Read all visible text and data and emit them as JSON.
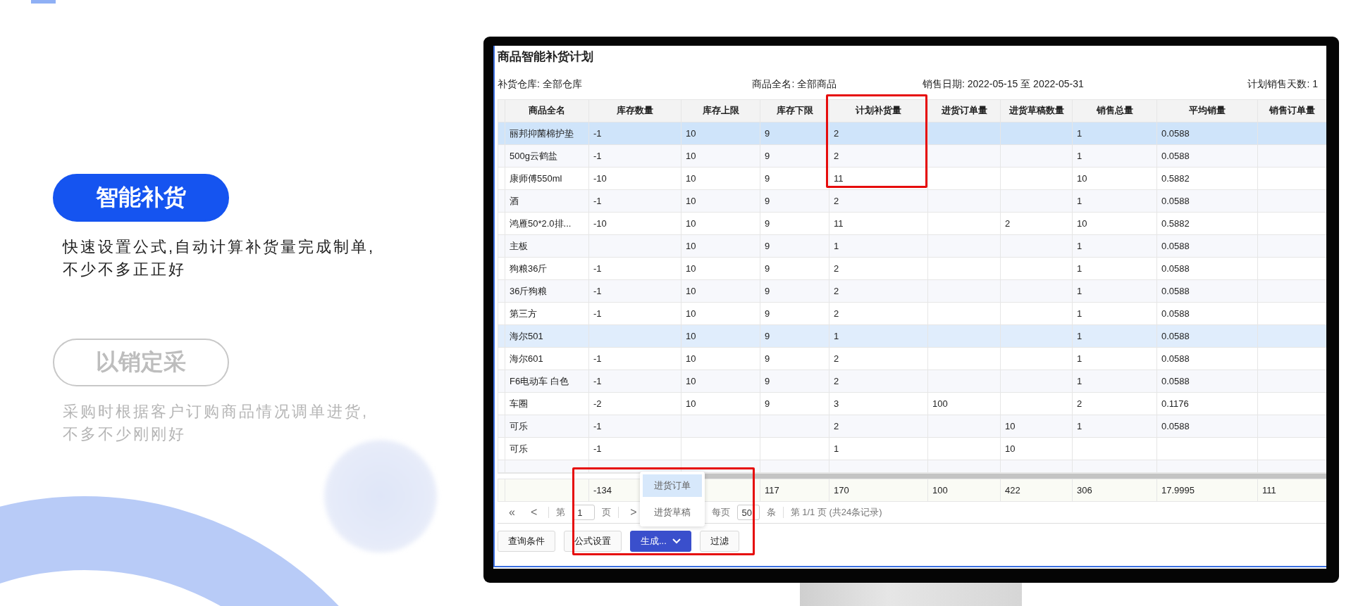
{
  "tabs": [
    {
      "label": "智能补货",
      "description": "快速设置公式,自动计算补货量完成制单,\n不少不多正正好",
      "selected": true
    },
    {
      "label": "以销定采",
      "description": "采购时根据客户订购商品情况调单进货,\n不多不少刚刚好",
      "selected": false
    }
  ],
  "screen": {
    "title": "商品智能补货计划",
    "filters": [
      "补货仓库: 全部仓库",
      "商品全名: 全部商品",
      "销售日期: 2022-05-15 至 2022-05-31",
      "计划销售天数: 1"
    ],
    "table": {
      "columns": [
        "商品全名",
        "库存数量",
        "库存上限",
        "库存下限",
        "计划补货量",
        "进货订单量",
        "进货草稿数量",
        "销售总量",
        "平均销量",
        "销售订单量"
      ],
      "rows": [
        {
          "cells": [
            "丽邦抑菌棉护垫",
            "-1",
            "10",
            "9",
            "2",
            null,
            null,
            "1",
            "0.0588",
            null
          ],
          "selected": true,
          "highlighted": false
        },
        {
          "cells": [
            "500g云鹤盐",
            "-1",
            "10",
            "9",
            "2",
            null,
            null,
            "1",
            "0.0588",
            null
          ],
          "selected": false,
          "highlighted": false
        },
        {
          "cells": [
            "康师傅550ml",
            "-10",
            "10",
            "9",
            "11",
            null,
            null,
            "10",
            "0.5882",
            null
          ],
          "selected": false,
          "highlighted": false
        },
        {
          "cells": [
            "酒",
            "-1",
            "10",
            "9",
            "2",
            null,
            null,
            "1",
            "0.0588",
            null
          ],
          "selected": false,
          "highlighted": false
        },
        {
          "cells": [
            "鸿雁50*2.0排...",
            "-10",
            "10",
            "9",
            "11",
            null,
            "2",
            "10",
            "0.5882",
            null
          ],
          "selected": false,
          "highlighted": false
        },
        {
          "cells": [
            "主板",
            null,
            "10",
            "9",
            "1",
            null,
            null,
            "1",
            "0.0588",
            null
          ],
          "selected": false,
          "highlighted": false
        },
        {
          "cells": [
            "狗粮36斤",
            "-1",
            "10",
            "9",
            "2",
            null,
            null,
            "1",
            "0.0588",
            null
          ],
          "selected": false,
          "highlighted": false
        },
        {
          "cells": [
            "36斤狗粮",
            "-1",
            "10",
            "9",
            "2",
            null,
            null,
            "1",
            "0.0588",
            null
          ],
          "selected": false,
          "highlighted": false
        },
        {
          "cells": [
            "第三方",
            "-1",
            "10",
            "9",
            "2",
            null,
            null,
            "1",
            "0.0588",
            null
          ],
          "selected": false,
          "highlighted": false
        },
        {
          "cells": [
            "海尔501",
            null,
            "10",
            "9",
            "1",
            null,
            null,
            "1",
            "0.0588",
            null
          ],
          "selected": false,
          "highlighted": true
        },
        {
          "cells": [
            "海尔601",
            "-1",
            "10",
            "9",
            "2",
            null,
            null,
            "1",
            "0.0588",
            null
          ],
          "selected": false,
          "highlighted": false
        },
        {
          "cells": [
            "F6电动车 白色",
            "-1",
            "10",
            "9",
            "2",
            null,
            null,
            "1",
            "0.0588",
            null
          ],
          "selected": false,
          "highlighted": false
        },
        {
          "cells": [
            "车圈",
            "-2",
            "10",
            "9",
            "3",
            "100",
            null,
            "2",
            "0.1176",
            null
          ],
          "selected": false,
          "highlighted": false
        },
        {
          "cells": [
            "可乐",
            "-1",
            null,
            null,
            "2",
            null,
            "10",
            "1",
            "0.0588",
            null
          ],
          "selected": false,
          "highlighted": false
        },
        {
          "cells": [
            "可乐",
            "-1",
            null,
            null,
            "1",
            null,
            "10",
            null,
            null,
            null
          ],
          "selected": false,
          "highlighted": false
        }
      ],
      "totals": {
        "column_2": "-134",
        "column_4": "117",
        "column_5": "170",
        "column_6": "100",
        "column_7": "422",
        "column_8": "306",
        "column_9": "17.9995",
        "column_10": "111"
      }
    },
    "pager": {
      "first": "«",
      "prev": "<",
      "page_prefix": "第",
      "page": "1",
      "page_suffix": "页",
      "next": ">",
      "per_page_prefix": "每页",
      "per_page": "50",
      "per_page_suffix": "条",
      "summary": "第 1/1 页 (共24条记录)"
    },
    "buttons": [
      {
        "label": "查询条件",
        "kind": "default"
      },
      {
        "label": "公式设置",
        "kind": "default"
      },
      {
        "label": "生成...",
        "kind": "primary-dropdown"
      },
      {
        "label": "过滤",
        "kind": "default"
      }
    ],
    "dropdown": [
      {
        "label": "进货订单",
        "selected": true
      },
      {
        "label": "进货草稿",
        "selected": false
      }
    ]
  }
}
